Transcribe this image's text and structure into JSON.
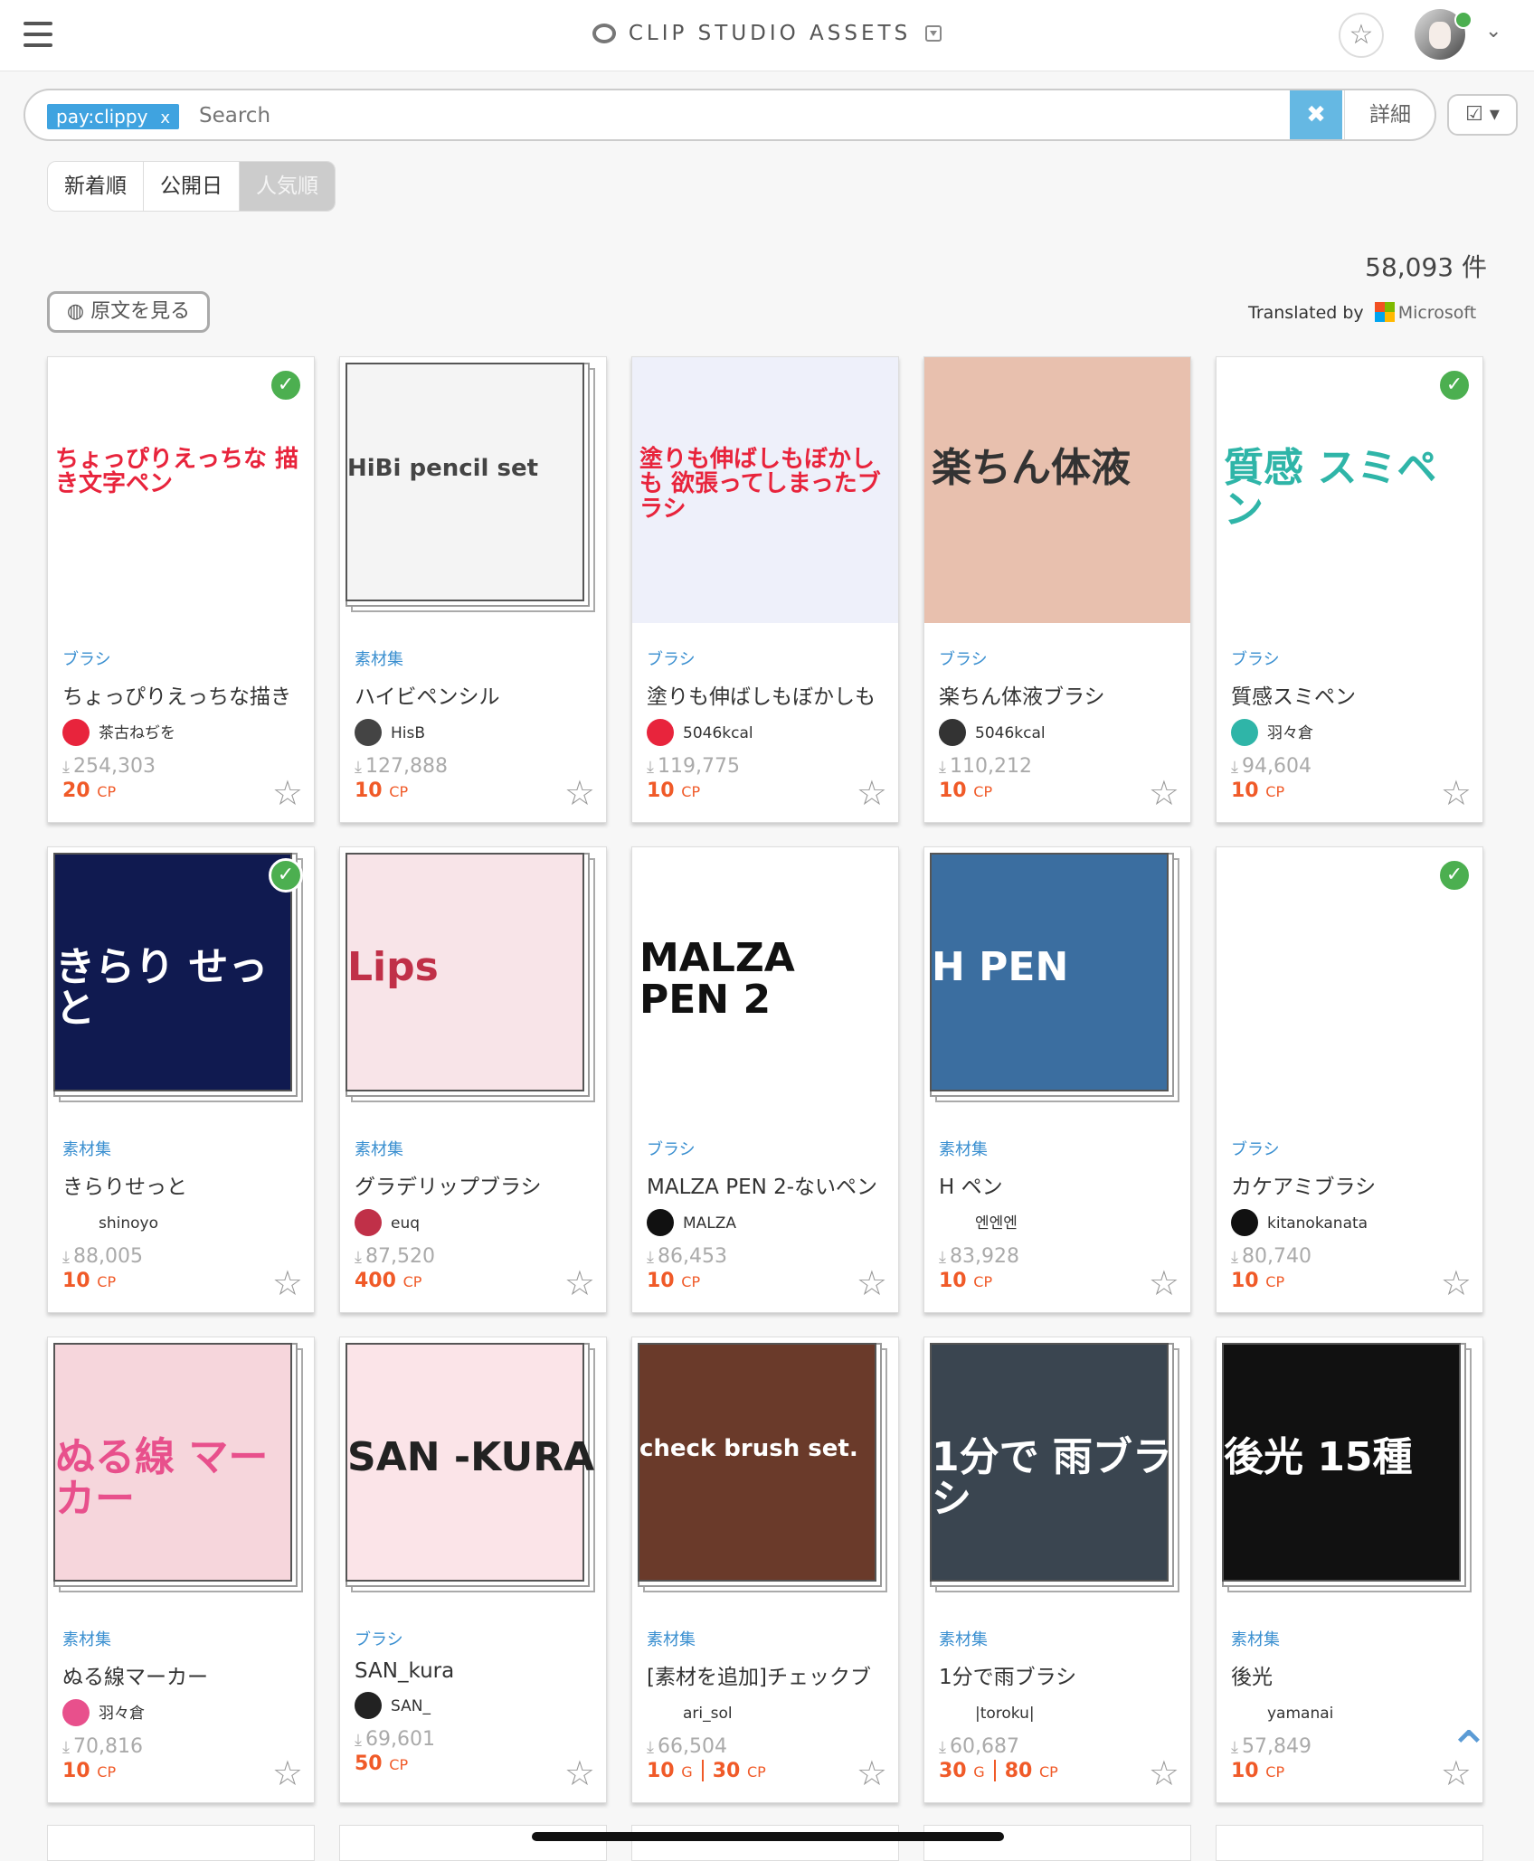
{
  "header": {
    "brand": "CLIP STUDIO ASSETS"
  },
  "search": {
    "tag_chip": "pay:clippy",
    "tag_remove": "x",
    "placeholder": "Search",
    "clear": "✖",
    "detail": "詳細"
  },
  "sort": {
    "options": [
      "新着順",
      "公開日",
      "人気順"
    ],
    "active": "人気順"
  },
  "result_count": "58,093 件",
  "original_button": "原文を見る",
  "translated_by": "Translated by",
  "translator": "Microsoft",
  "cards": [
    {
      "category": "ブラシ",
      "title": "ちょっぴりえっちな描き",
      "author": "茶古ねぢを",
      "downloads": "254,303",
      "price": "20",
      "price_unit": "CP",
      "checked": true,
      "art_text": "ちょっぴりえっちな 描き文字ペン",
      "art_colors": [
        "#ffffff",
        "#e8243c"
      ]
    },
    {
      "category": "素材集",
      "title": "ハイビペンシル",
      "author": "HisB",
      "downloads": "127,888",
      "price": "10",
      "price_unit": "CP",
      "checked": false,
      "art_text": "HiBi pencil set",
      "art_colors": [
        "#f4f4f4",
        "#444444"
      ]
    },
    {
      "category": "ブラシ",
      "title": "塗りも伸ばしもぼかしも",
      "author": "5046kcal",
      "downloads": "119,775",
      "price": "10",
      "price_unit": "CP",
      "checked": false,
      "art_text": "塗りも伸ばしもぼかしも 欲張ってしまったブラシ",
      "art_colors": [
        "#eef0fa",
        "#e8243c"
      ]
    },
    {
      "category": "ブラシ",
      "title": "楽ちん体液ブラシ",
      "author": "5046kcal",
      "downloads": "110,212",
      "price": "10",
      "price_unit": "CP",
      "checked": false,
      "art_text": "楽ちん体液",
      "art_colors": [
        "#e8c0ae",
        "#333333"
      ]
    },
    {
      "category": "ブラシ",
      "title": "質感スミペン",
      "author": "羽々倉",
      "downloads": "94,604",
      "price": "10",
      "price_unit": "CP",
      "checked": true,
      "art_text": "質感 スミペン",
      "art_colors": [
        "#ffffff",
        "#2fb5a8"
      ]
    },
    {
      "category": "素材集",
      "title": "きらりせっと",
      "author": "shinoyo",
      "downloads": "88,005",
      "price": "10",
      "price_unit": "CP",
      "checked": true,
      "art_text": "きらり せっと",
      "art_colors": [
        "#101a50",
        "#ffffff"
      ]
    },
    {
      "category": "素材集",
      "title": "グラデリップブラシ",
      "author": "euq",
      "downloads": "87,520",
      "price": "400",
      "price_unit": "CP",
      "checked": false,
      "art_text": "Lips",
      "art_colors": [
        "#f8e4e8",
        "#c03048"
      ]
    },
    {
      "category": "ブラシ",
      "title": "MALZA PEN 2-ないペン",
      "author": "MALZA",
      "downloads": "86,453",
      "price": "10",
      "price_unit": "CP",
      "checked": false,
      "art_text": "MALZA PEN 2",
      "art_colors": [
        "#ffffff",
        "#111111"
      ]
    },
    {
      "category": "素材集",
      "title": "H ペン",
      "author": "엔엔엔",
      "downloads": "83,928",
      "price": "10",
      "price_unit": "CP",
      "checked": false,
      "art_text": "H PEN",
      "art_colors": [
        "#3b6ea0",
        "#ffffff"
      ]
    },
    {
      "category": "ブラシ",
      "title": "カケアミブラシ",
      "author": "kitanokanata",
      "downloads": "80,740",
      "price": "10",
      "price_unit": "CP",
      "checked": true,
      "art_text": "",
      "art_colors": [
        "#ffffff",
        "#111111"
      ]
    },
    {
      "category": "素材集",
      "title": "ぬる線マーカー",
      "author": "羽々倉",
      "downloads": "70,816",
      "price": "10",
      "price_unit": "CP",
      "checked": false,
      "art_text": "ぬる線 マーカー",
      "art_colors": [
        "#f6d6dc",
        "#e8508c"
      ]
    },
    {
      "category": "ブラシ",
      "title": "SAN_kura",
      "author": "SAN_",
      "downloads": "69,601",
      "price": "50",
      "price_unit": "CP",
      "checked": false,
      "art_text": "SAN -KURA",
      "art_colors": [
        "#fbe4e8",
        "#222222"
      ]
    },
    {
      "category": "素材集",
      "title": "[素材を追加]チェックブ",
      "author": "ari_sol",
      "downloads": "66,504",
      "price": "10",
      "price_unit": "G",
      "price2": "30",
      "price2_unit": "CP",
      "checked": false,
      "art_text": "check brush set.",
      "art_colors": [
        "#6a3a2a",
        "#ffffff"
      ]
    },
    {
      "category": "素材集",
      "title": "1分で雨ブラシ",
      "author": "|toroku|",
      "downloads": "60,687",
      "price": "30",
      "price_unit": "G",
      "price2": "80",
      "price2_unit": "CP",
      "checked": false,
      "art_text": "1分で 雨ブラシ",
      "art_colors": [
        "#3a4550",
        "#ffffff"
      ]
    },
    {
      "category": "素材集",
      "title": "後光",
      "author": "yamanai",
      "downloads": "57,849",
      "price": "10",
      "price_unit": "CP",
      "checked": false,
      "art_text": "後光 15種",
      "art_colors": [
        "#111111",
        "#ffffff"
      ]
    }
  ]
}
